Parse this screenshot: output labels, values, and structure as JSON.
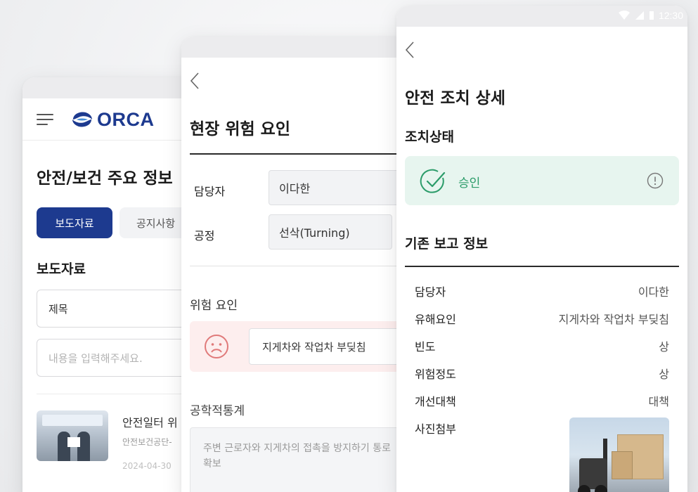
{
  "phone1": {
    "logo_text": "ORCA",
    "title": "안전/보건 주요 정보",
    "tabs": [
      {
        "label": "보도자료",
        "active": true
      },
      {
        "label": "공지사항",
        "active": false
      }
    ],
    "section_title": "보도자료",
    "title_input_placeholder": "제목",
    "content_input_placeholder": "내용을 입력해주세요.",
    "news": {
      "title": "안전일터 위",
      "source": "안전보건공단-",
      "date": "2024-04-30"
    },
    "accent_color": "#1d3a8f"
  },
  "phone2": {
    "title": "현장 위험 요인",
    "fields": [
      {
        "label": "담당자",
        "value": "이다한"
      },
      {
        "label": "공정",
        "value": "선삭(Turning)"
      }
    ],
    "hazard_label": "위험 요인",
    "hazard_value": "지게차와 작업차 부딪침",
    "hazard_icon": "sad-face-icon",
    "engineering_label": "공학적통계",
    "engineering_text": "주변 근로자와 지게차의 접촉을 방지하기 통로 확보"
  },
  "phone3": {
    "status_time": "12:30",
    "title": "안전 조치 상세",
    "status_section": "조치상태",
    "approval_text": "승인",
    "approval_color": "#2c9c6a",
    "report_section": "기존 보고 정보",
    "rows": [
      {
        "label": "담당자",
        "value": "이다한"
      },
      {
        "label": "유해요인",
        "value": "지게차와 작업차 부딪침"
      },
      {
        "label": "빈도",
        "value": "상"
      },
      {
        "label": "위험정도",
        "value": "상"
      },
      {
        "label": "개선대책",
        "value": "대책"
      },
      {
        "label": "사진첨부",
        "value": ""
      }
    ],
    "photo_icon": "forklift-photo"
  }
}
